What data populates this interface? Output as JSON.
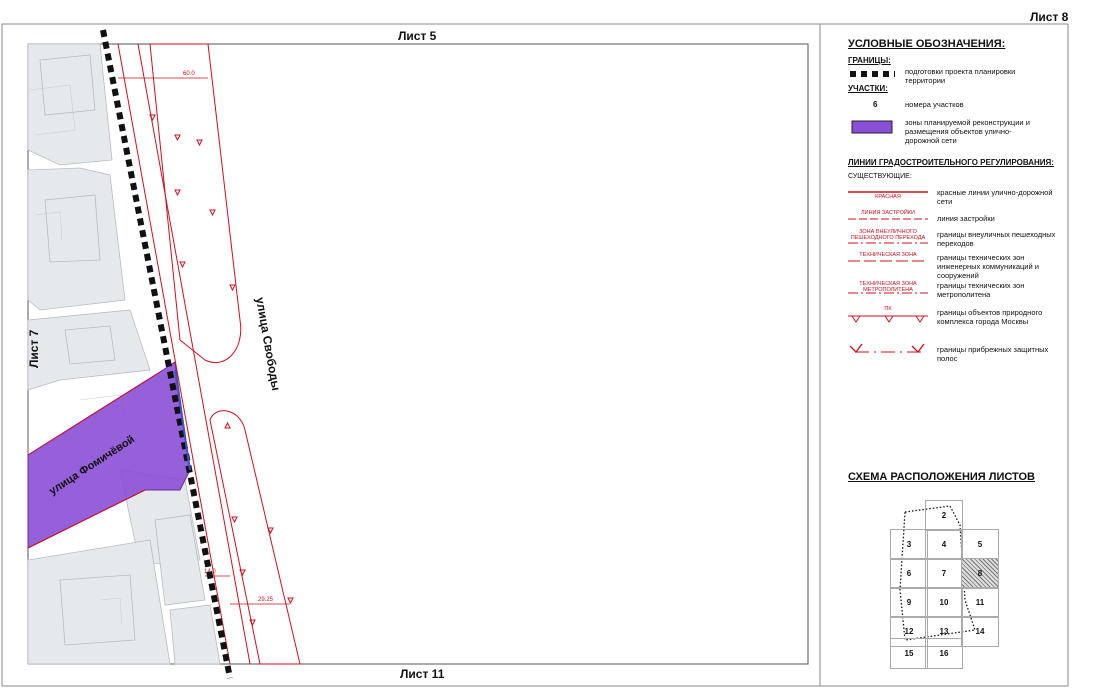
{
  "sheet_title": "Лист 8",
  "map": {
    "neighbor_top": "Лист 5",
    "neighbor_bottom": "Лист 11",
    "neighbor_left": "Лист 7",
    "street_vertical": "улица Свободы",
    "street_diagonal": "улица Фомичёвой",
    "dim_top": "60.0",
    "dim_left": "14.0",
    "dim_mid": "29.25"
  },
  "legend": {
    "title": "УСЛОВНЫЕ ОБОЗНАЧЕНИЯ:",
    "boundaries_header": "ГРАНИЦЫ:",
    "boundary_project": "подготовки проекта планировки территории",
    "plots_header": "УЧАСТКИ:",
    "plot_number_sample": "6",
    "plot_number_label": "номера участков",
    "zone_label": "зоны планируемой реконструкции и размещения объектов улично-дорожной сети",
    "lines_header": "ЛИНИИ ГРАДОСТРОИТЕЛЬНОГО РЕГУЛИРОВАНИЯ:",
    "existing_header": "СУЩЕСТВУЮЩИЕ:",
    "items": [
      {
        "tag": "КРАСНАЯ",
        "label": "красные линии улично-дорожной сети"
      },
      {
        "tag": "ЛИНИЯ ЗАСТРОЙКИ",
        "label": "линия застройки"
      },
      {
        "tag": "ЗОНА ВНЕУЛИЧНОГО ПЕШЕХОДНОГО ПЕРЕХОДА",
        "label": "границы внеуличных пешеходных переходов"
      },
      {
        "tag": "ТЕХНИЧЕСКАЯ ЗОНА",
        "label": "границы технических зон инженерных коммуникаций и сооружений"
      },
      {
        "tag": "ТЕХНИЧЕСКАЯ ЗОНА МЕТРОПОЛИТЕНА",
        "label": "границы технических зон метрополитена"
      },
      {
        "tag": "ПК",
        "label": "границы объектов природного комплекса города Москвы"
      },
      {
        "tag": "",
        "label": "границы прибрежных защитных полос"
      }
    ]
  },
  "sheet_scheme": {
    "title": "СХЕМА РАСПОЛОЖЕНИЯ ЛИСТОВ",
    "cells": [
      "2",
      "3",
      "4",
      "5",
      "6",
      "7",
      "8",
      "9",
      "10",
      "11",
      "12",
      "13",
      "14",
      "15",
      "16"
    ],
    "highlighted": "8"
  },
  "colors": {
    "red_line": "#cc1020",
    "zone_fill": "#8a4fd6",
    "boundary": "#111111"
  }
}
